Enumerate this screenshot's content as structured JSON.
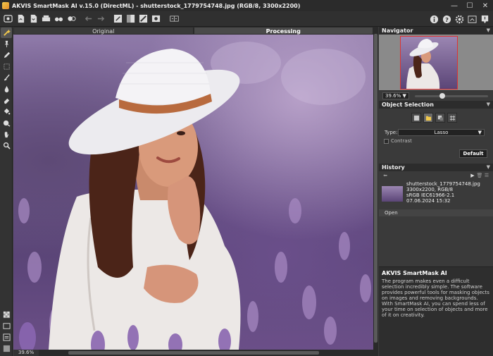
{
  "window": {
    "title": "AKVIS SmartMask AI v.15.0 (DirectML) - shutterstock_1779754748.jpg (RGB/8, 3300x2200)",
    "controls": {
      "minimize": "—",
      "maximize": "☐",
      "close": "✕"
    }
  },
  "toolbar": {
    "left_icons": [
      "home-icon",
      "open-file-icon",
      "save-file-icon",
      "print-icon",
      "cursor-pair-icon",
      "toggle-icon",
      "undo-icon",
      "redo-icon",
      "run-icon",
      "compare-icon",
      "mask-icon",
      "photo-icon",
      "split-view-icon"
    ],
    "right_icons": [
      "info-icon",
      "help-icon",
      "settings-icon",
      "share-icon",
      "notification-icon"
    ]
  },
  "tabs": {
    "original": "Original",
    "processing": "Processing"
  },
  "status": {
    "zoom": "39.6%"
  },
  "navigator": {
    "header": "Navigator",
    "zoom_value": "39.6%",
    "zoom_arrow": "▼",
    "zoom_slider_fraction": 0.36
  },
  "object_selection": {
    "header": "Object Selection",
    "type_label": "Type:",
    "type_value": "Lasso",
    "type_arrow": "▼",
    "contrast_label": "Contrast",
    "default_button": "Default"
  },
  "history": {
    "header": "History",
    "entry": {
      "filename": "shutterstock_1779754748.jpg",
      "size": "3300x2200, RGB/8",
      "profile": "sRGB IEC61966-2.1",
      "date": "07.06.2024 15:32"
    },
    "open_label": "Open"
  },
  "info": {
    "title": "AKVIS SmartMask AI",
    "text": "The program makes even a difficult selection incredibly simple. The software provides powerful tools for masking objects on images and removing backgrounds. With SmartMask AI, you can spend less of your time on selection of objects and more of it on creativity."
  },
  "colors": {
    "background": "#3c3c3c",
    "panel": "#3a3a3a",
    "header": "#2c2c2c",
    "lavender": "#8e79a8"
  }
}
